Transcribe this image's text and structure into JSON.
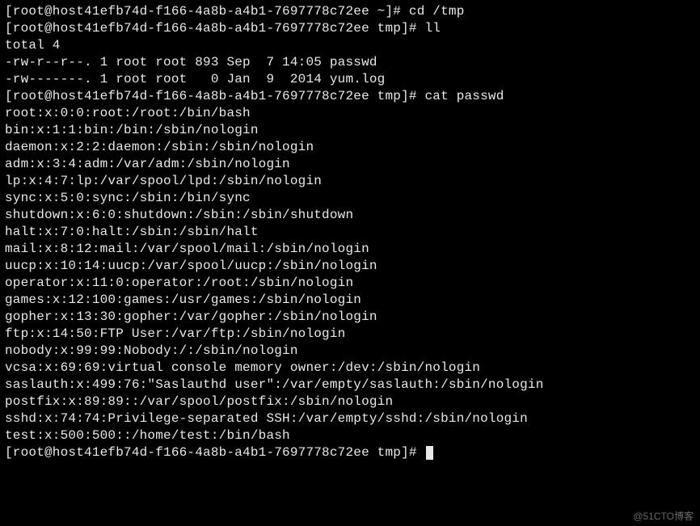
{
  "prompt1_open": "[root@host41efb74d-f166-4a8b-a4b1-7697778c72ee ~]# ",
  "cmd1": "cd /tmp",
  "prompt2_open": "[root@host41efb74d-f166-4a8b-a4b1-7697778c72ee tmp]# ",
  "cmd2": "ll",
  "ll_total": "total 4",
  "ll_rows": [
    "-rw-r--r--. 1 root root 893 Sep  7 14:05 passwd",
    "-rw-------. 1 root root   0 Jan  9  2014 yum.log"
  ],
  "prompt3_open": "[root@host41efb74d-f166-4a8b-a4b1-7697778c72ee tmp]# ",
  "cmd3": "cat passwd",
  "passwd_lines": [
    "root:x:0:0:root:/root:/bin/bash",
    "bin:x:1:1:bin:/bin:/sbin/nologin",
    "daemon:x:2:2:daemon:/sbin:/sbin/nologin",
    "adm:x:3:4:adm:/var/adm:/sbin/nologin",
    "lp:x:4:7:lp:/var/spool/lpd:/sbin/nologin",
    "sync:x:5:0:sync:/sbin:/bin/sync",
    "shutdown:x:6:0:shutdown:/sbin:/sbin/shutdown",
    "halt:x:7:0:halt:/sbin:/sbin/halt",
    "mail:x:8:12:mail:/var/spool/mail:/sbin/nologin",
    "uucp:x:10:14:uucp:/var/spool/uucp:/sbin/nologin",
    "operator:x:11:0:operator:/root:/sbin/nologin",
    "games:x:12:100:games:/usr/games:/sbin/nologin",
    "gopher:x:13:30:gopher:/var/gopher:/sbin/nologin",
    "ftp:x:14:50:FTP User:/var/ftp:/sbin/nologin",
    "nobody:x:99:99:Nobody:/:/sbin/nologin",
    "vcsa:x:69:69:virtual console memory owner:/dev:/sbin/nologin",
    "saslauth:x:499:76:\"Saslauthd user\":/var/empty/saslauth:/sbin/nologin",
    "postfix:x:89:89::/var/spool/postfix:/sbin/nologin",
    "sshd:x:74:74:Privilege-separated SSH:/var/empty/sshd:/sbin/nologin",
    "test:x:500:500::/home/test:/bin/bash"
  ],
  "prompt4_open": "[root@host41efb74d-f166-4a8b-a4b1-7697778c72ee tmp]# ",
  "watermark": "@51CTO博客"
}
